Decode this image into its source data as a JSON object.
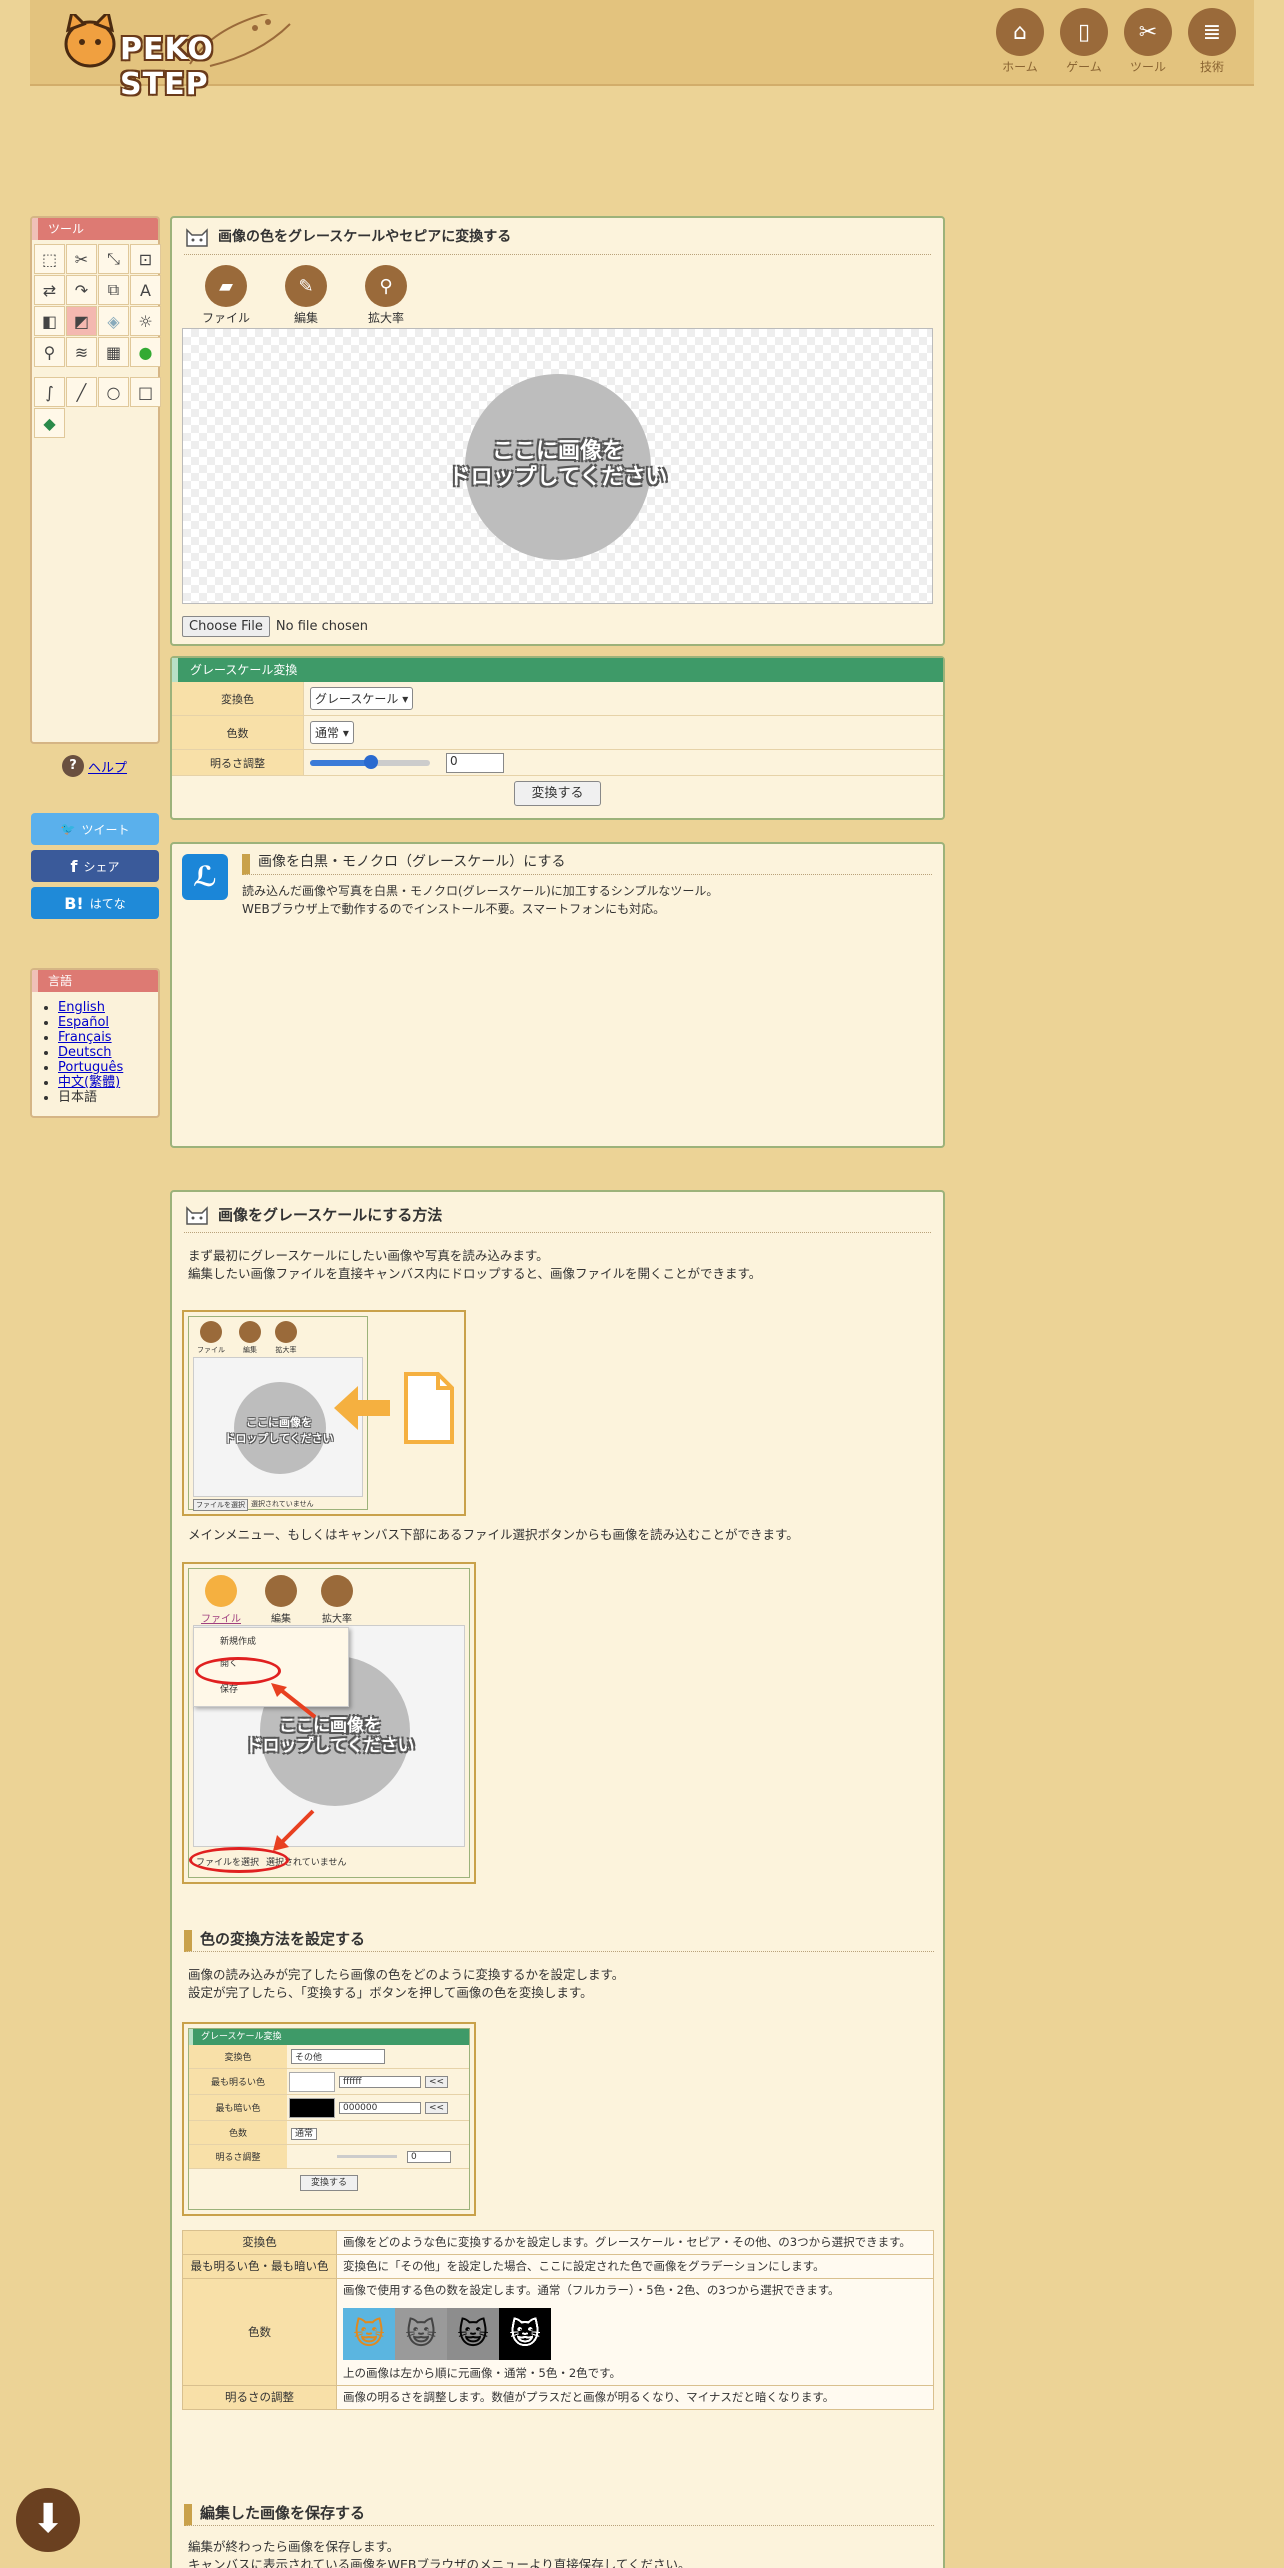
{
  "header": {
    "logo_text": "PEKO STEP",
    "nav": [
      {
        "label": "ホーム",
        "icon": "home-icon"
      },
      {
        "label": "ゲーム",
        "icon": "smartphone-icon"
      },
      {
        "label": "ツール",
        "icon": "tools-icon"
      },
      {
        "label": "技術",
        "icon": "document-icon"
      }
    ]
  },
  "sidebar": {
    "title": "ツール",
    "help": "ヘルプ",
    "share": {
      "tweet": "ツイート",
      "facebook": "シェア",
      "hatena": "はてな"
    }
  },
  "language": {
    "title": "言語",
    "items": [
      "English",
      "Español",
      "Français",
      "Deutsch",
      "Português",
      "中文(繁體)",
      "日本語"
    ]
  },
  "editor": {
    "title": "画像の色をグレースケールやセピアに変換する",
    "buttons": {
      "file": "ファイル",
      "edit": "編集",
      "zoom": "拡大率"
    },
    "drop_text_1": "ここに画像を",
    "drop_text_2": "ドロップしてください",
    "choose_file": "Choose File",
    "no_file": "No file chosen"
  },
  "grayscale": {
    "title": "グレースケール変換",
    "convert_color_label": "変換色",
    "convert_color_value": "グレースケール",
    "color_count_label": "色数",
    "color_count_value": "通常",
    "brightness_label": "明るさ調整",
    "brightness_value": "0",
    "convert_button": "変換する"
  },
  "description": {
    "title": "画像を白黒・モノクロ（グレースケール）にする",
    "line1": "読み込んだ画像や写真を白黒・モノクロ(グレースケール)に加工するシンプルなツール。",
    "line2": "WEBブラウザ上で動作するのでインストール不要。スマートフォンにも対応。"
  },
  "howto": {
    "title": "画像をグレースケールにする方法",
    "p1_line1": "まず最初にグレースケールにしたい画像や写真を読み込みます。",
    "p1_line2": "編集したい画像ファイルを直接キャンバス内にドロップすると、画像ファイルを開くことができます。",
    "p2": "メインメニュー、もしくはキャンバス下部にあるファイル選択ボタンからも画像を読み込むことができます。",
    "shot1": {
      "file": "ファイル",
      "edit": "編集",
      "zoom": "拡大率",
      "drop1": "ここに画像を",
      "drop2": "ドロップしてください",
      "choose": "ファイルを選択",
      "none": "選択されていません"
    },
    "shot2": {
      "file": "ファイル",
      "edit": "編集",
      "zoom": "拡大率",
      "menu_new": "新規作成",
      "menu_open": "開く",
      "menu_save": "保存",
      "drop1": "ここに画像を",
      "drop2": "ドロップしてください",
      "choose": "ファイルを選択",
      "none": "選択されていません"
    },
    "sec2_title": "色の変換方法を設定する",
    "p3_line1": "画像の読み込みが完了したら画像の色をどのように変換するかを設定します。",
    "p3_line2": "設定が完了したら、「変換する」ボタンを押して画像の色を変換します。",
    "shot3": {
      "title": "グレースケール変換",
      "rows": [
        {
          "label": "変換色",
          "value": "その他"
        },
        {
          "label": "最も明るい色",
          "value": "ffffff"
        },
        {
          "label": "最も暗い色",
          "value": "000000"
        },
        {
          "label": "色数",
          "value": "通常"
        },
        {
          "label": "明るさ調整",
          "value": "0"
        }
      ],
      "arrow": "<<",
      "button": "変換する"
    },
    "table": [
      {
        "key": "変換色",
        "value": "画像をどのような色に変換するかを設定します。グレースケール・セピア・その他、の3つから選択できます。"
      },
      {
        "key": "最も明るい色・最も暗い色",
        "value": "変換色に「その他」を設定した場合、ここに設定された色で画像をグラデーションにします。"
      },
      {
        "key": "色数",
        "value": "画像で使用する色の数を設定します。通常（フルカラー）・5色・2色、の3つから選択できます。",
        "note": "上の画像は左から順に元画像・通常・5色・2色です。"
      },
      {
        "key": "明るさの調整",
        "value": "画像の明るさを調整します。数値がプラスだと画像が明るくなり、マイナスだと暗くなります。"
      }
    ],
    "sec3_title": "編集した画像を保存する",
    "p4_line1": "編集が終わったら画像を保存します。",
    "p4_line2": "キャンバスに表示されている画像をWEBブラウザのメニューより直接保存してください。"
  },
  "colors": {
    "brown": "#9a6a3a",
    "green_header": "#3e9a68",
    "red_header": "#dd7a73",
    "bg": "#ecd396"
  }
}
